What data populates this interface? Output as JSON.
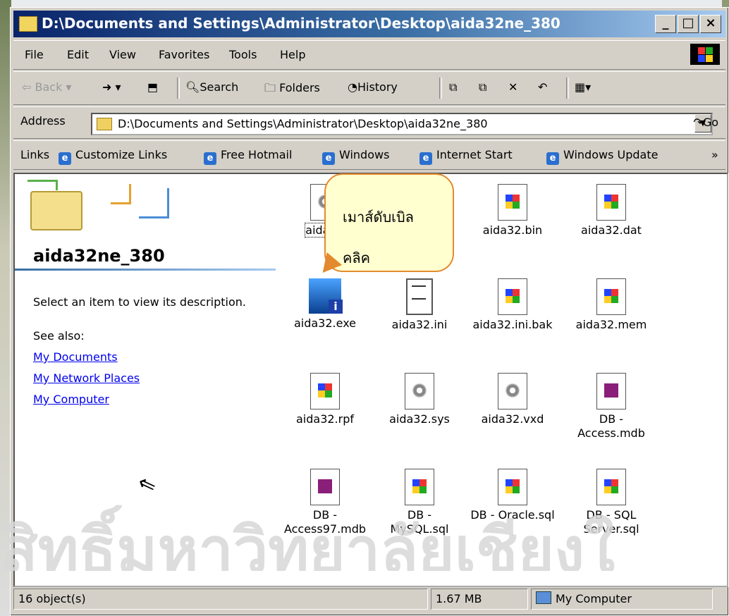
{
  "window": {
    "title": "D:\\Documents and Settings\\Administrator\\Desktop\\aida32ne_380",
    "min_label": "_",
    "max_label": "□",
    "close_label": "×"
  },
  "menu": {
    "items": [
      "File",
      "Edit",
      "View",
      "Favorites",
      "Tools",
      "Help"
    ]
  },
  "toolbar": {
    "back": "Back",
    "search": "Search",
    "folders": "Folders",
    "history": "History"
  },
  "address": {
    "label": "Address",
    "value": "D:\\Documents and Settings\\Administrator\\Desktop\\aida32ne_380",
    "go": "Go"
  },
  "links": {
    "label": "Links",
    "items": [
      "Customize Links",
      "Free Hotmail",
      "Windows",
      "Internet Start",
      "Windows Update"
    ]
  },
  "left_pane": {
    "title": "aida32ne_380",
    "description": "Select an item to view its description.",
    "see_also": "See also:",
    "links": [
      "My Documents",
      "My Network Places",
      "My Computer"
    ]
  },
  "files": [
    {
      "name": "aida_ic",
      "icon": "gear-document-icon"
    },
    {
      "name": "aida32.bin",
      "icon": "windows-flag-document-icon"
    },
    {
      "name": "aida32.dat",
      "icon": "windows-flag-document-icon"
    },
    {
      "name": "aida32.exe",
      "icon": "computer-info-icon"
    },
    {
      "name": "aida32.ini",
      "icon": "settings-document-icon"
    },
    {
      "name": "aida32.ini.bak",
      "icon": "windows-flag-document-icon"
    },
    {
      "name": "aida32.mem",
      "icon": "windows-flag-document-icon"
    },
    {
      "name": "aida32.rpf",
      "icon": "windows-flag-document-icon"
    },
    {
      "name": "aida32.sys",
      "icon": "gear-document-icon"
    },
    {
      "name": "aida32.vxd",
      "icon": "gear-document-icon"
    },
    {
      "name_line1": "DB -",
      "name_line2": "Access.mdb",
      "icon": "access-database-icon"
    },
    {
      "name_line1": "DB -",
      "name_line2": "Access97.mdb",
      "icon": "access-database-icon"
    },
    {
      "name_line1": "DB -",
      "name_line2": "MySQL.sql",
      "icon": "windows-flag-document-icon"
    },
    {
      "name": "DB - Oracle.sql",
      "icon": "windows-flag-document-icon"
    },
    {
      "name_line1": "DB - SQL",
      "name_line2": "Server.sql",
      "icon": "windows-flag-document-icon"
    }
  ],
  "callout": {
    "line1": "เมาส์ดับเบิล",
    "line2": "คลิค"
  },
  "watermark": "สิทธิ์มหาวิทยาลัยเชียงใ",
  "status": {
    "objects": "16 object(s)",
    "size": "1.67 MB",
    "location": "My Computer"
  }
}
